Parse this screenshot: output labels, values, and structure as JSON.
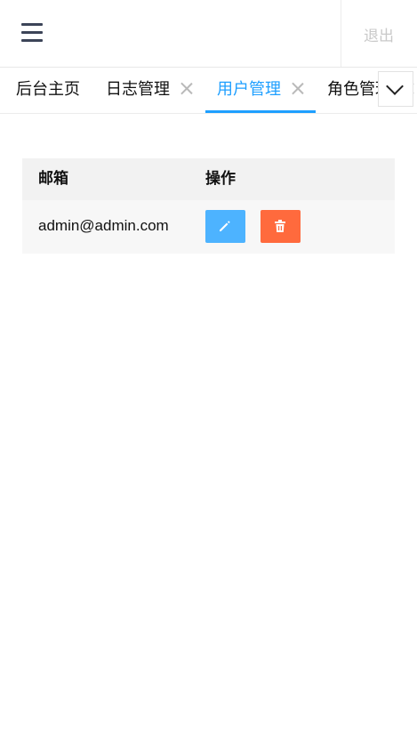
{
  "header": {
    "menu_icon": "hamburger-menu-icon",
    "logout_label": "退出"
  },
  "tabs": [
    {
      "label": "后台主页",
      "closable": false,
      "active": false
    },
    {
      "label": "日志管理",
      "closable": true,
      "active": false
    },
    {
      "label": "用户管理",
      "closable": true,
      "active": true
    },
    {
      "label": "角色管理",
      "closable": true,
      "active": false
    }
  ],
  "tabs_more_icon": "chevron-down-icon",
  "table": {
    "columns": [
      "邮箱",
      "操作"
    ],
    "rows": [
      {
        "email": "admin@admin.com",
        "actions": [
          "edit-icon",
          "trash-icon"
        ]
      }
    ]
  },
  "colors": {
    "accent": "#1e9fff",
    "edit_button": "#4db3ff",
    "delete_button": "#ff6a3d",
    "header_bg": "#f2f2f2"
  }
}
